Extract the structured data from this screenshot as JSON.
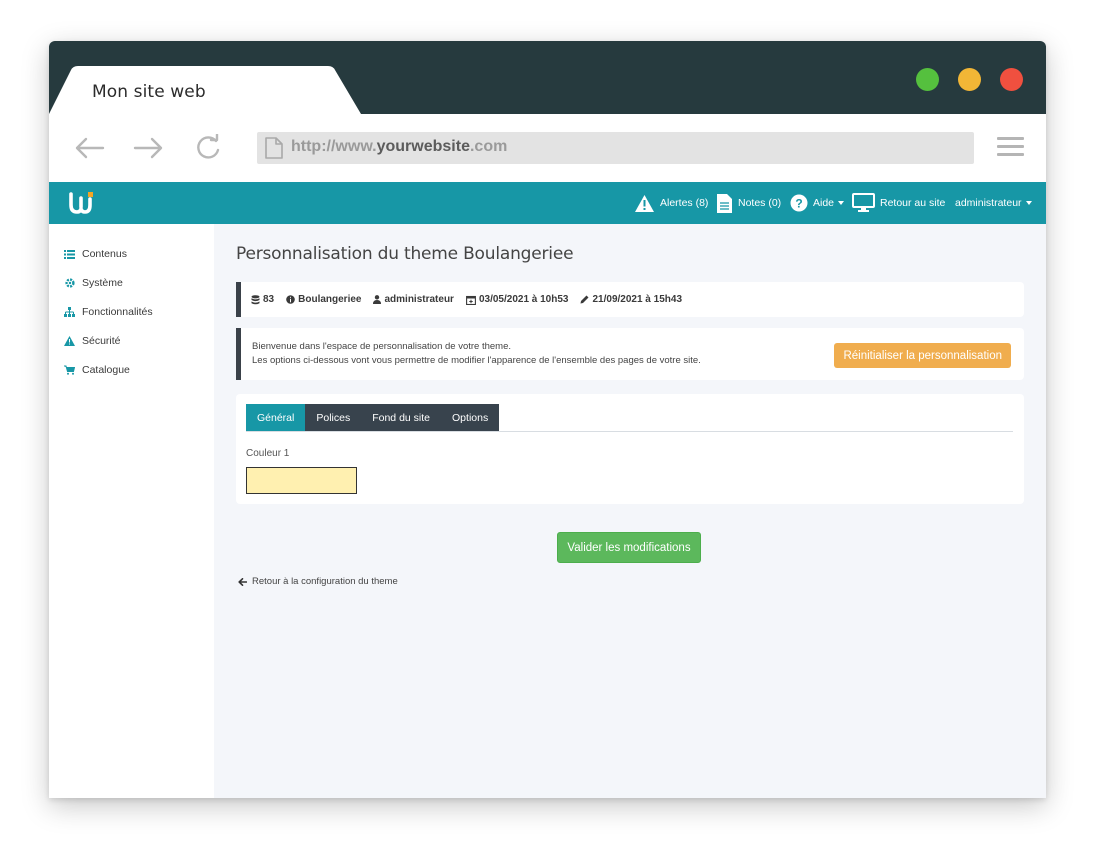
{
  "browser": {
    "tab_title": "Mon site web",
    "url_prefix": "http://www.",
    "url_domain": "yourwebsite",
    "url_suffix": ".com"
  },
  "topbar": {
    "alerts": "Alertes (8)",
    "notes": "Notes (0)",
    "help": "Aide",
    "back_to_site": "Retour au site",
    "user": "administrateur"
  },
  "sidebar": {
    "items": [
      {
        "label": "Contenus",
        "icon": "list-icon"
      },
      {
        "label": "Système",
        "icon": "gear-icon"
      },
      {
        "label": "Fonctionnalités",
        "icon": "sitemap-icon"
      },
      {
        "label": "Sécurité",
        "icon": "warning-icon"
      },
      {
        "label": "Catalogue",
        "icon": "cart-icon"
      }
    ]
  },
  "page": {
    "title": "Personnalisation du theme Boulangeriee",
    "meta": {
      "id": "83",
      "name": "Boulangeriee",
      "author": "administrateur",
      "created": "03/05/2021 à 10h53",
      "modified": "21/09/2021 à 15h43"
    },
    "welcome_line1": "Bienvenue dans l'espace de personnalisation de votre theme.",
    "welcome_line2": "Les options ci-dessous vont vous permettre de modifier l'apparence de l'ensemble des pages de votre site.",
    "reset_button": "Réinitialiser la personnalisation",
    "tabs": [
      "Général",
      "Polices",
      "Fond du site",
      "Options"
    ],
    "active_tab": "Général",
    "color1_label": "Couleur 1",
    "color1_value": "#fff0b0",
    "validate_button": "Valider les modifications",
    "back_link": "Retour à la configuration du theme"
  },
  "colors": {
    "titlebar": "#263a3e",
    "accent": "#1797a6",
    "reset": "#f0ad4e",
    "validate": "#5cb85c",
    "tab_dark": "#38434d"
  }
}
